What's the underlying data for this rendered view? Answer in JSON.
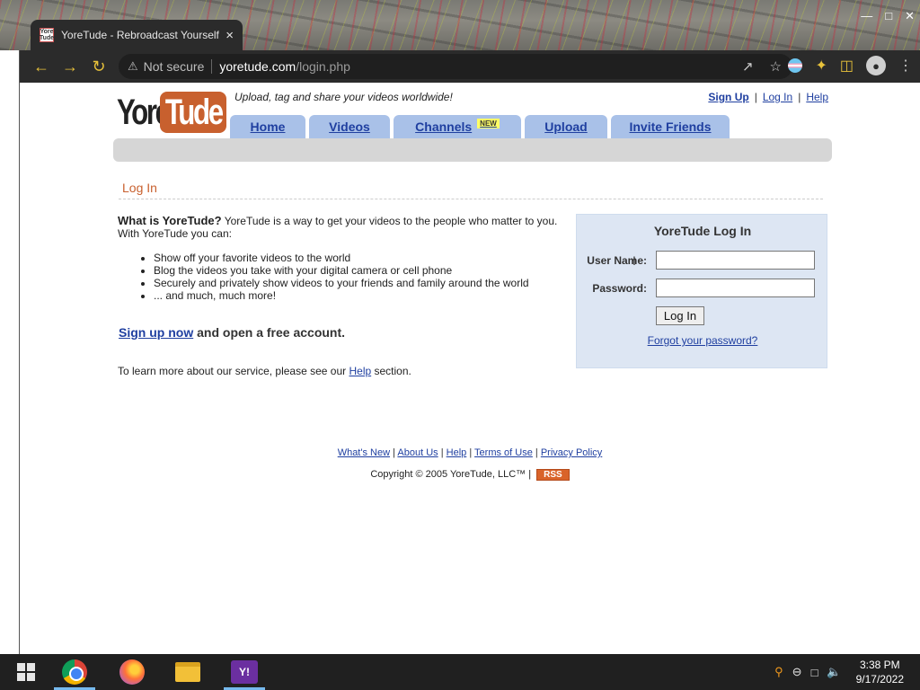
{
  "browser": {
    "tab_title": "YoreTude - Rebroadcast Yourself.",
    "tab_close": "×",
    "favicon_text": "Yore Tude",
    "security_label": "Not secure",
    "url_host": "yoretude.com",
    "url_path": "/login.php"
  },
  "site": {
    "logo_left": "Yore",
    "logo_right": "Tude",
    "tagline": "Upload, tag and share your videos worldwide!",
    "top_links": {
      "sign_up": "Sign Up",
      "log_in": "Log In",
      "help": "Help",
      "separator": "|"
    },
    "nav_tabs": [
      {
        "label": "Home",
        "width": 84
      },
      {
        "label": "Videos",
        "width": 90
      },
      {
        "label": "Channels",
        "badge": "NEW",
        "width": 142
      },
      {
        "label": "Upload",
        "width": 92
      },
      {
        "label": "Invite Friends",
        "width": 132
      }
    ]
  },
  "content": {
    "section_title": "Log In",
    "intro_bold": "What is YoreTude?",
    "intro_text": " YoreTude is a way to get your videos to the people who matter to you. With YoreTude you can:",
    "features": [
      "Show off your favorite videos to the world",
      "Blog the videos you take with your digital camera or cell phone",
      "Securely and privately show videos to your friends and family around the world",
      "... and much, much more!"
    ],
    "signup_link": "Sign up now",
    "signup_rest": " and open a free account.",
    "learn_more_prefix": "To learn more about our service, please see our ",
    "learn_more_link": "Help",
    "learn_more_suffix": " section."
  },
  "login": {
    "title": "YoreTude Log In",
    "username_label": "User Name:",
    "username_value": "",
    "password_label": "Password:",
    "password_value": "",
    "submit_label": "Log In",
    "forgot_link": "Forgot your password?"
  },
  "footer": {
    "links": [
      "What's New",
      "About Us",
      "Help",
      "Terms of Use",
      "Privacy Policy"
    ],
    "separator": " | ",
    "copyright": "Copyright © 2005 YoreTude, LLC™ | ",
    "rss": "RSS"
  },
  "taskbar": {
    "time": "3:38 PM",
    "date": "9/17/2022"
  },
  "colors": {
    "accent_orange": "#c8602e",
    "link_blue": "#1f3fa0",
    "tab_blue": "#a9c1e8",
    "login_box": "#dde6f3"
  }
}
